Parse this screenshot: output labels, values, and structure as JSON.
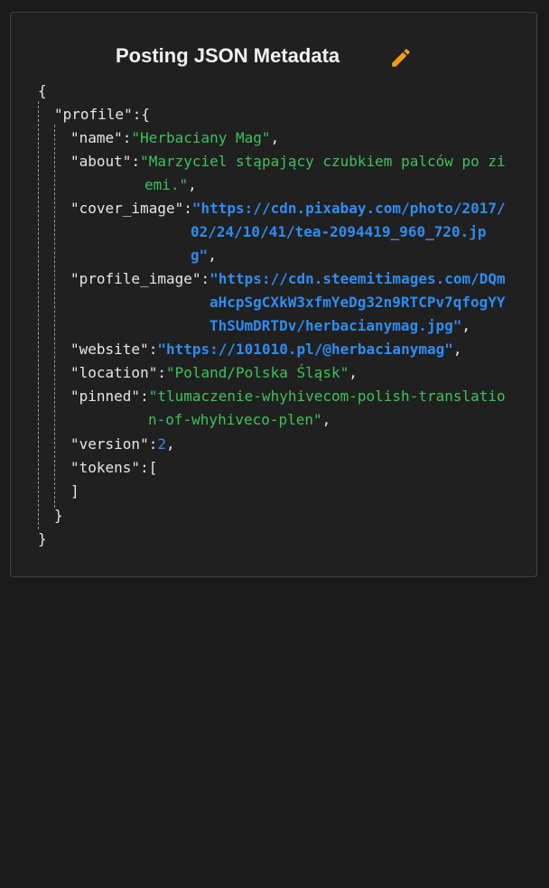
{
  "title": "Posting JSON Metadata",
  "icons": {
    "edit": "pencil-icon"
  },
  "colors": {
    "background": "#1a1a1a",
    "card": "#202020",
    "border": "#3f3f3f",
    "edit_icon": "#f39c12",
    "string": "#3cc25a",
    "url": "#2f8cf0",
    "number": "#2f8cf0",
    "text": "#e6e6e6"
  },
  "json": {
    "open_root": "{",
    "profile_key": "\"profile\"",
    "profile_open": ":{",
    "name_key": "\"name\"",
    "name_value": "\"Herbaciany Mag\"",
    "about_key": "\"about\"",
    "about_value_1": "\"Marzyciel stąpający czubkiem palców po zi",
    "about_value_2": "emi.\"",
    "cover_key": "\"cover_image\"",
    "cover_value_1": "\"https://cdn.pixabay.com/photo/2017/",
    "cover_value_2": "02/24/10/41/tea-2094419_960_720.jp",
    "cover_value_3": "g\"",
    "profile_image_key": "\"profile_image\"",
    "profile_image_value_1": "\"https://cdn.steemitimages.com/DQm",
    "profile_image_value_2": "aHcpSgCXkW3xfmYeDg32n9RTCPv7qfogYY",
    "profile_image_value_3": "ThSUmDRTDv/herbacianymag.jpg\"",
    "website_key": "\"website\"",
    "website_value": "\"https://101010.pl/@herbacianymag\"",
    "location_key": "\"location\"",
    "location_value": "\"Poland/Polska Śląsk\"",
    "pinned_key": "\"pinned\"",
    "pinned_value_1": "\"tlumaczenie-whyhivecom-polish-translatio",
    "pinned_value_2": "n-of-whyhiveco-plen\"",
    "version_key": "\"version\"",
    "version_value": "2",
    "tokens_key": "\"tokens\"",
    "tokens_open": ":[",
    "tokens_close": "]",
    "profile_close": "}",
    "close_root": "}",
    "colon": ":",
    "comma": ","
  }
}
